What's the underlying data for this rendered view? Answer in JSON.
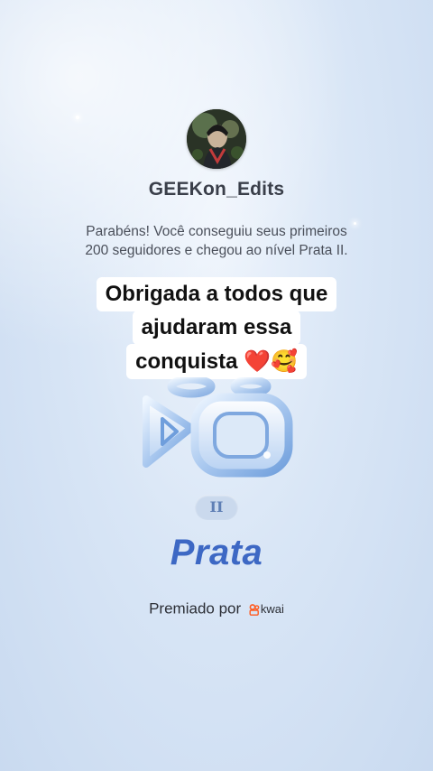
{
  "profile": {
    "username": "GEEKon_Edits",
    "avatar_icon": "profile-avatar"
  },
  "achievement": {
    "message_line1": "Parabéns! Você conseguiu seus primeiros",
    "message_line2": "200 seguidores e chegou ao nível Prata II.",
    "level": "II",
    "tier": "Prata",
    "awarded_by_label": "Premiado por",
    "brand": "kwai"
  },
  "caption": {
    "line1": "Obrigada a todos que",
    "line2": "ajudaram essa",
    "line3_text": "conquista ",
    "line3_emoji": "❤️🥰"
  },
  "colors": {
    "tier_blue": "#3d68c4",
    "kwai_orange": "#ff5a1f",
    "background": "#d9e6f6"
  }
}
